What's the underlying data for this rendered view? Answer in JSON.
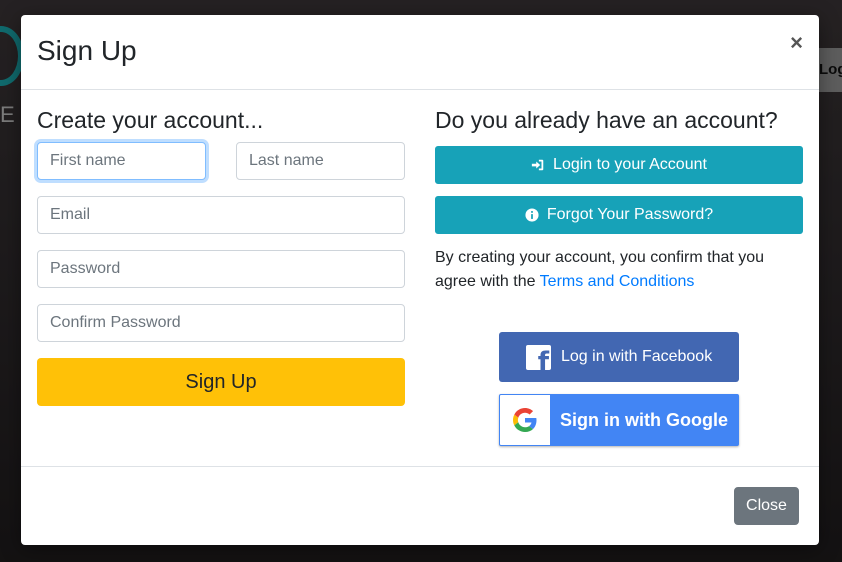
{
  "background": {
    "logo_letter": "E",
    "nav_button_label": "Log"
  },
  "modal": {
    "title": "Sign Up",
    "close_symbol": "×",
    "left": {
      "heading": "Create your account...",
      "fields": {
        "first_name": {
          "placeholder": "First name",
          "value": ""
        },
        "last_name": {
          "placeholder": "Last name",
          "value": ""
        },
        "email": {
          "placeholder": "Email",
          "value": ""
        },
        "password": {
          "placeholder": "Password",
          "value": ""
        },
        "confirm_password": {
          "placeholder": "Confirm Password",
          "value": ""
        }
      },
      "signup_button": "Sign Up"
    },
    "right": {
      "heading": "Do you already have an account?",
      "login_button": "Login to your Account",
      "forgot_button": "Forgot Your Password?",
      "terms_prefix": "By creating your account, you confirm that you agree with the",
      "terms_link": "Terms and Conditions",
      "facebook_button": "Log in with Facebook",
      "google_button": "Sign in with Google"
    },
    "footer": {
      "close_button": "Close"
    }
  },
  "colors": {
    "teal": "#17a2b8",
    "yellow": "#ffc107",
    "link": "#007bff",
    "facebook": "#4267b2",
    "google": "#4285f4",
    "secondary": "#6c757d"
  },
  "icons": {
    "login_icon": "sign-in-icon",
    "forgot_icon": "info-circle-icon",
    "facebook_icon": "facebook-icon",
    "google_icon": "google-g-icon"
  }
}
